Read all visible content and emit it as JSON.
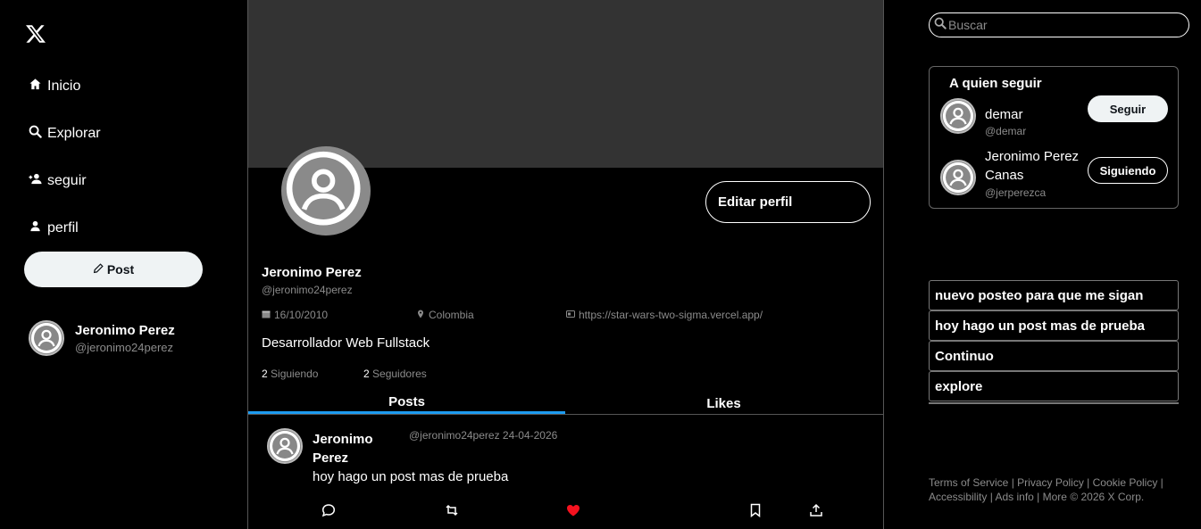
{
  "nav": {
    "items": [
      {
        "label": "Inicio",
        "icon": "home-icon"
      },
      {
        "label": "Explorar",
        "icon": "search-icon"
      },
      {
        "label": "seguir",
        "icon": "user-plus-icon"
      },
      {
        "label": "perfil",
        "icon": "user-icon"
      }
    ],
    "post_label": "Post"
  },
  "me": {
    "name": "Jeronimo Perez",
    "handle": "@jeronimo24perez"
  },
  "profile": {
    "edit_label": "Editar perfil",
    "name": "Jeronimo Perez",
    "handle": "@jeronimo24perez",
    "date": "16/10/2010",
    "location": "Colombia",
    "website": "https://star-wars-two-sigma.vercel.app/",
    "bio": "Desarrollador Web Fullstack",
    "following_count": "2",
    "following_label": "Siguiendo",
    "followers_count": "2",
    "followers_label": "Seguidores"
  },
  "tabs": [
    {
      "label": "Posts",
      "active": true
    },
    {
      "label": "Likes",
      "active": false
    }
  ],
  "post": {
    "author": "Jeronimo Perez",
    "handle": "@jeronimo24perez",
    "date": "24-04-2026",
    "text": "hoy hago un post mas de prueba",
    "liked_color": "#f91880"
  },
  "search": {
    "placeholder": "Buscar"
  },
  "who_to_follow": {
    "title": "A quien seguir",
    "users": [
      {
        "name": "demar",
        "handle": "@demar",
        "button": "Seguir"
      },
      {
        "name": "Jeronimo Perez Canas",
        "handle": "@jerperezca",
        "button": "Siguiendo"
      }
    ]
  },
  "trends": [
    "nuevo posteo para que me sigan",
    "hoy hago un post mas de prueba",
    "Continuo",
    "explore"
  ],
  "footer": {
    "links": [
      "Terms of Service",
      "Privacy Policy",
      "Cookie Policy",
      "Accessibility",
      "Ads info",
      "More"
    ],
    "copyright": "© 2026 X Corp."
  },
  "colors": {
    "accent": "#1d9bf0",
    "like": "#f91880",
    "banner": "#333333"
  }
}
